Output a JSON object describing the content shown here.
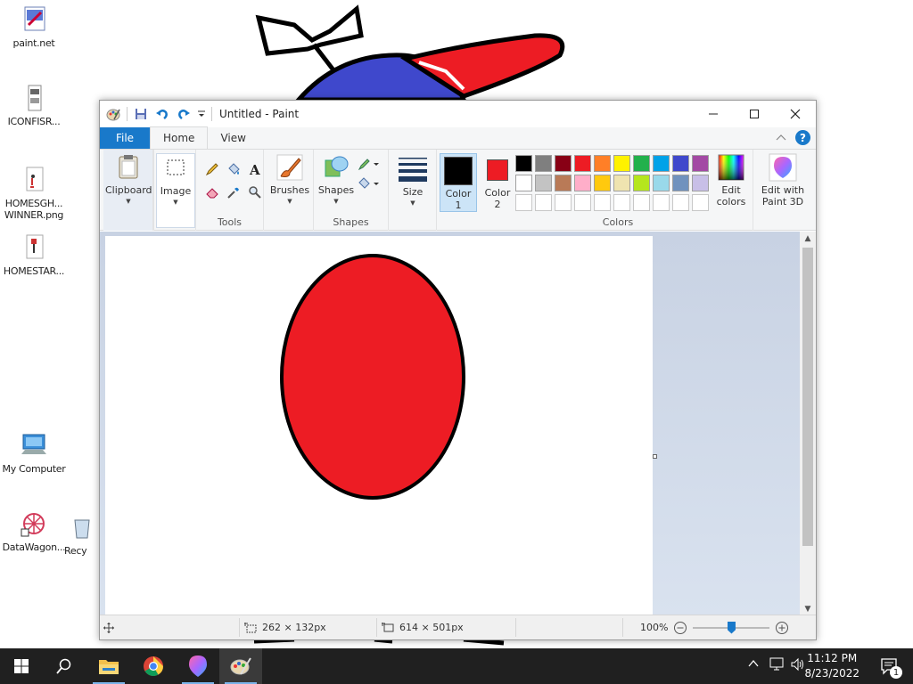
{
  "desktop": {
    "icons": [
      {
        "label": "paint.net",
        "icon": "paintnet-app-icon"
      },
      {
        "label": "ICONFISR...",
        "icon": "image-file-icon"
      },
      {
        "label": "HOMESGH... WINNER.png",
        "icon": "png-file-icon"
      },
      {
        "label": "HOMESTAR...",
        "icon": "png-file-icon"
      },
      {
        "label": "My Computer",
        "icon": "computer-icon"
      },
      {
        "label": "DataWagon...",
        "icon": "network-shortcut-icon"
      },
      {
        "label": "Recy",
        "icon": "recycle-bin-icon"
      }
    ]
  },
  "window": {
    "title": "Untitled - Paint",
    "controls": [
      "minimize",
      "maximize",
      "close"
    ]
  },
  "ribbon": {
    "tabs": [
      {
        "label": "File"
      },
      {
        "label": "Home"
      },
      {
        "label": "View"
      }
    ],
    "active_tab": "Home",
    "groups": {
      "clipboard": {
        "label": "Clipboard"
      },
      "image": {
        "label": "Image"
      },
      "tools": {
        "label": "Tools"
      },
      "brushes": {
        "label": "Brushes"
      },
      "shapes": {
        "label": "Shapes",
        "button_label": "Shapes"
      },
      "size": {
        "label": "Size"
      },
      "color1": {
        "label": "Color",
        "number": "1",
        "value": "#000000"
      },
      "color2": {
        "label": "Color",
        "number": "2",
        "value": "#ed1c24"
      },
      "colors": {
        "label": "Colors"
      },
      "edit_colors": {
        "label": "Edit",
        "label2": "colors"
      },
      "paint3d": {
        "label": "Edit with",
        "label2": "Paint 3D"
      }
    },
    "palette": [
      [
        "#000000",
        "#7f7f7f",
        "#880015",
        "#ed1c24",
        "#ff7f27",
        "#fff200",
        "#22b14c",
        "#00a2e8",
        "#3f48cc",
        "#a349a4"
      ],
      [
        "#ffffff",
        "#c3c3c3",
        "#b97a57",
        "#ffaec9",
        "#ffc90e",
        "#efe4b0",
        "#b5e61d",
        "#99d9ea",
        "#7092be",
        "#c8bfe7"
      ],
      [
        "",
        "",
        "",
        "",
        "",
        "",
        "",
        "",
        "",
        ""
      ]
    ]
  },
  "canvas": {
    "shape": "ellipse",
    "fill": "#ed1c24",
    "outline": "#000000"
  },
  "status": {
    "selection_size": "262 × 132px",
    "image_size": "614 × 501px",
    "zoom": "100%",
    "zoom_level": 0.5
  },
  "taskbar": {
    "items": [
      "start",
      "search",
      "file-explorer",
      "chrome",
      "paint3d",
      "paint"
    ],
    "time": "11:12 PM",
    "date": "8/23/2022",
    "notification_count": "1"
  },
  "colors": {
    "accent": "#1979ca",
    "wallpaper_hat_blue": "#3f48cc",
    "wallpaper_hat_red": "#ed1c24"
  }
}
